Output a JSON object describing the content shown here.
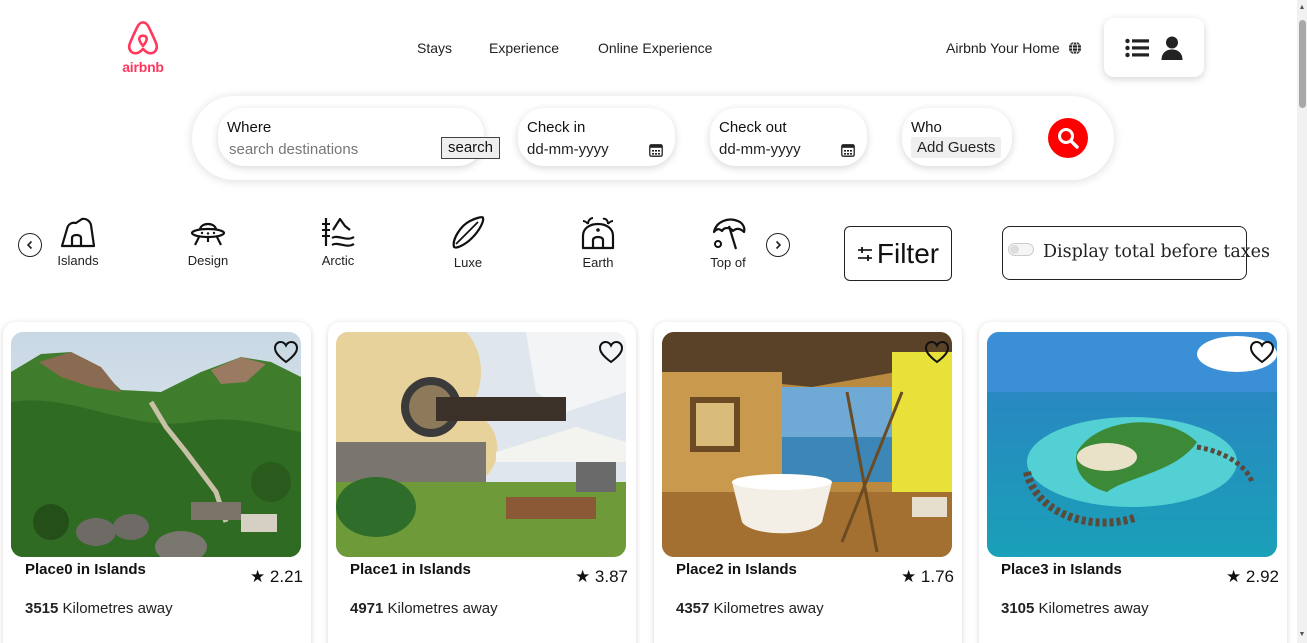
{
  "brand": {
    "name": "airbnb",
    "color": "#ff385c"
  },
  "nav": {
    "stays": "Stays",
    "experience": "Experience",
    "online": "Online Experience"
  },
  "host": {
    "label": "Airbnb Your Home",
    "icon": "globe-icon"
  },
  "user_menu": {
    "icons": [
      "list-icon",
      "user-icon"
    ]
  },
  "search": {
    "where_label": "Where",
    "where_placeholder": "search destinations",
    "search_button": "search",
    "checkin_label": "Check in",
    "checkin_value": "dd-mm-yyyy",
    "checkout_label": "Check out",
    "checkout_value": "dd-mm-yyyy",
    "who_label": "Who",
    "guests_button": "Add Guests",
    "submit_color": "#ff0000"
  },
  "categories": [
    {
      "label": "Islands",
      "icon": "island-icon"
    },
    {
      "label": "Design",
      "icon": "ufo-icon"
    },
    {
      "label": "Arctic",
      "icon": "arctic-icon"
    },
    {
      "label": "Luxe",
      "icon": "surfboard-icon"
    },
    {
      "label": "Earth",
      "icon": "earth-home-icon"
    },
    {
      "label": "Top of",
      "icon": "umbrella-icon"
    }
  ],
  "filter": {
    "label": "Filter"
  },
  "taxes": {
    "label": "Display total before taxes",
    "enabled": false
  },
  "listings": [
    {
      "title": "Place0 in Islands",
      "rating": "★ 2.21",
      "distance_value": "3515",
      "distance_unit": "Kilometres away"
    },
    {
      "title": "Place1 in Islands",
      "rating": "★ 3.87",
      "distance_value": "4971",
      "distance_unit": "Kilometres away"
    },
    {
      "title": "Place2 in Islands",
      "rating": "★ 1.76",
      "distance_value": "4357",
      "distance_unit": "Kilometres away"
    },
    {
      "title": "Place3 in Islands",
      "rating": "★ 2.92",
      "distance_value": "3105",
      "distance_unit": "Kilometres away"
    }
  ]
}
